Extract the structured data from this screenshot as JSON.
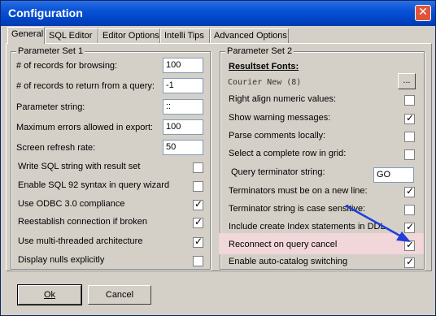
{
  "window": {
    "title": "Configuration"
  },
  "tabs": [
    "General",
    "SQL Editor",
    "Editor Options",
    "Intelli Tips",
    "Advanced Options"
  ],
  "set1": {
    "legend": "Parameter Set 1",
    "fields": [
      {
        "label": "# of records for browsing:",
        "value": "100"
      },
      {
        "label": "# of records to return from a query:",
        "value": "-1"
      },
      {
        "label": "Parameter string:",
        "value": "::"
      },
      {
        "label": "Maximum errors allowed in export:",
        "value": "100"
      },
      {
        "label": "Screen refresh rate:",
        "value": "50"
      }
    ],
    "checks": [
      {
        "label": "Write SQL string with result set",
        "checked": false
      },
      {
        "label": "Enable SQL 92 syntax in query wizard",
        "checked": false
      },
      {
        "label": "Use ODBC 3.0 compliance",
        "checked": true
      },
      {
        "label": "Reestablish connection if broken",
        "checked": true
      },
      {
        "label": "Use multi-threaded architecture",
        "checked": true
      },
      {
        "label": "Display nulls explicitly",
        "checked": false
      }
    ]
  },
  "set2": {
    "legend": "Parameter Set 2",
    "fonts_heading": "Resultset Fonts:",
    "font_value": "Courier New (8)",
    "browse_label": "...",
    "items": [
      {
        "label": "Right align numeric values:",
        "type": "check",
        "checked": false
      },
      {
        "label": "Show warning messages:",
        "type": "check",
        "checked": true
      },
      {
        "label": "Parse comments locally:",
        "type": "check",
        "checked": false
      },
      {
        "label": "Select a complete row in grid:",
        "type": "check",
        "checked": false
      },
      {
        "label": "Query terminator string:",
        "type": "input",
        "value": "GO"
      },
      {
        "label": "Terminators must be on a new line:",
        "type": "check",
        "checked": true
      },
      {
        "label": "Terminator string is case sensitive:",
        "type": "check",
        "checked": false
      },
      {
        "label": "Include create Index statements in DDL",
        "type": "check",
        "checked": true
      },
      {
        "label": "Reconnect on query cancel",
        "type": "check",
        "checked": true,
        "highlighted": true
      },
      {
        "label": "Enable auto-catalog switching",
        "type": "check",
        "checked": true
      }
    ]
  },
  "buttons": {
    "ok": "Ok",
    "cancel": "Cancel"
  },
  "colors": {
    "highlight": "#f1d6da",
    "arrow": "#1f3fd8",
    "titlebar": "#0a54d8"
  },
  "icons": {
    "close": "close-icon",
    "arrow": "annotation-arrow-icon",
    "check": "check-icon"
  }
}
